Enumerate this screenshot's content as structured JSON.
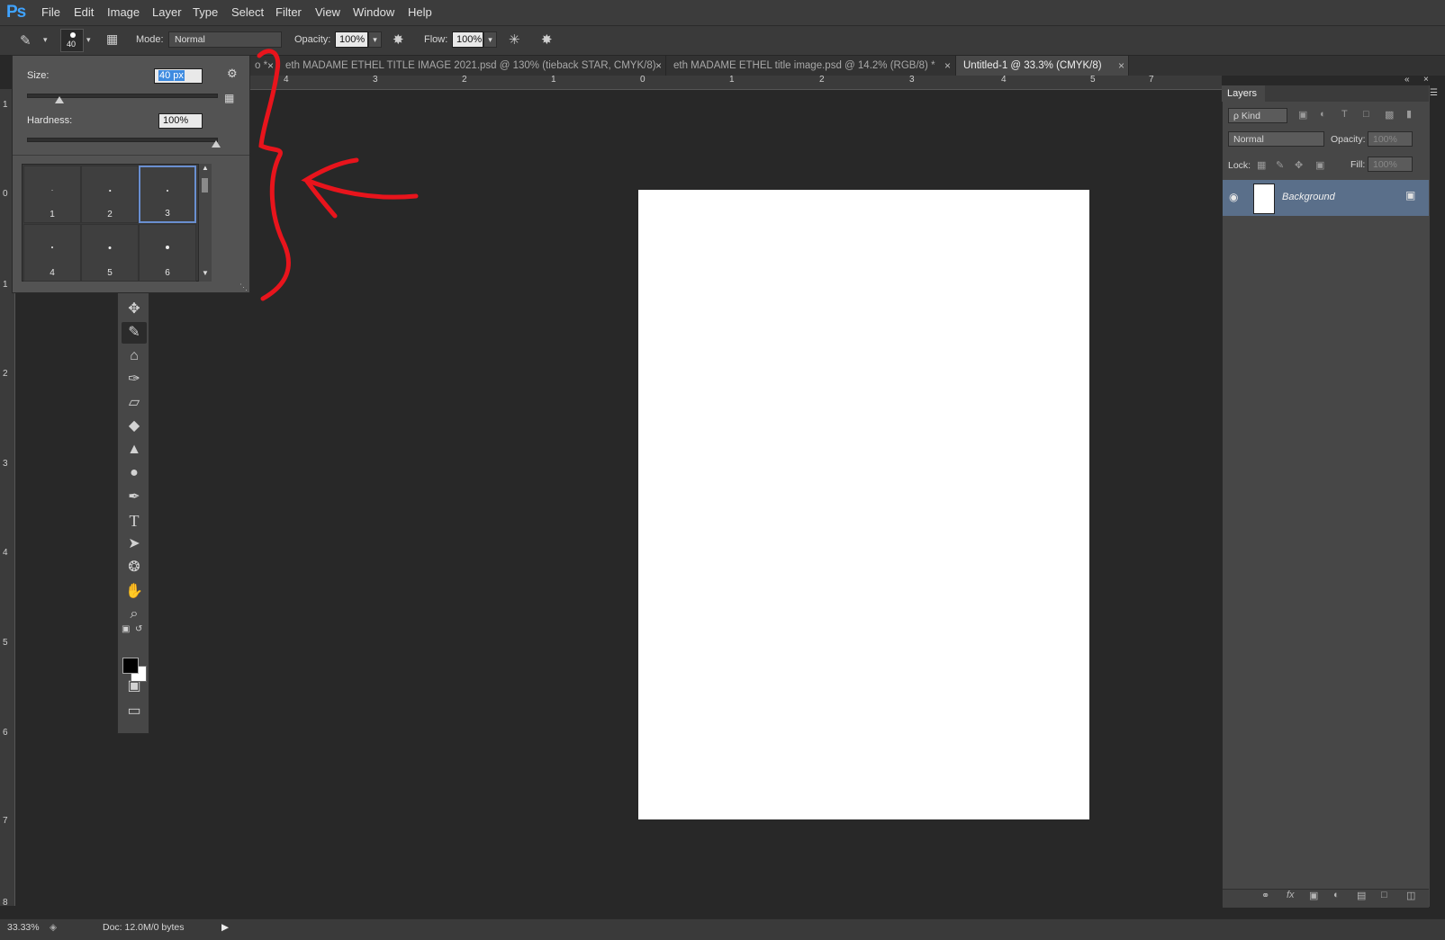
{
  "app": {
    "logo": "Ps"
  },
  "menu": [
    "File",
    "Edit",
    "Image",
    "Layer",
    "Type",
    "Select",
    "Filter",
    "View",
    "Window",
    "Help"
  ],
  "options_bar": {
    "brush_size": "40",
    "mode_label": "Mode:",
    "mode_value": "Normal",
    "opacity_label": "Opacity:",
    "opacity_value": "100%",
    "flow_label": "Flow:",
    "flow_value": "100%"
  },
  "tabs": [
    {
      "label": "o *",
      "active": false
    },
    {
      "label": "eth MADAME ETHEL TITLE IMAGE 2021.psd @ 130% (tieback STAR, CMYK/8)",
      "active": false
    },
    {
      "label": "eth MADAME ETHEL title image.psd @ 14.2% (RGB/8) *",
      "active": false
    },
    {
      "label": "Untitled-1 @ 33.3% (CMYK/8)",
      "active": true
    }
  ],
  "brush_popup": {
    "size_label": "Size:",
    "size_value": "40 px",
    "hardness_label": "Hardness:",
    "hardness_value": "100%",
    "size_slider_level": 0.17,
    "hardness_slider_level": 1.0,
    "presets": [
      "1",
      "2",
      "3",
      "4",
      "5",
      "6"
    ],
    "selected_preset": "3"
  },
  "ruler_top": [
    "4",
    "3",
    "2",
    "1",
    "0",
    "1",
    "2",
    "3",
    "4",
    "5",
    "7"
  ],
  "ruler_left": [
    "1",
    "0",
    "1",
    "2",
    "3",
    "4",
    "5",
    "6",
    "7",
    "8"
  ],
  "layers_panel": {
    "title": "Layers",
    "filter_label": "ρ Kind",
    "blend_mode": "Normal",
    "opacity_label": "Opacity:",
    "opacity_value": "100%",
    "lock_label": "Lock:",
    "fill_label": "Fill:",
    "fill_value": "100%",
    "layers": [
      {
        "name": "Background",
        "locked": true,
        "visible": true
      }
    ]
  },
  "status": {
    "zoom": "33.33%",
    "doc": "Doc: 12.0M/0 bytes"
  },
  "icons": {
    "annotation_color": "#e8141c",
    "selection_color": "#3e8be0"
  }
}
